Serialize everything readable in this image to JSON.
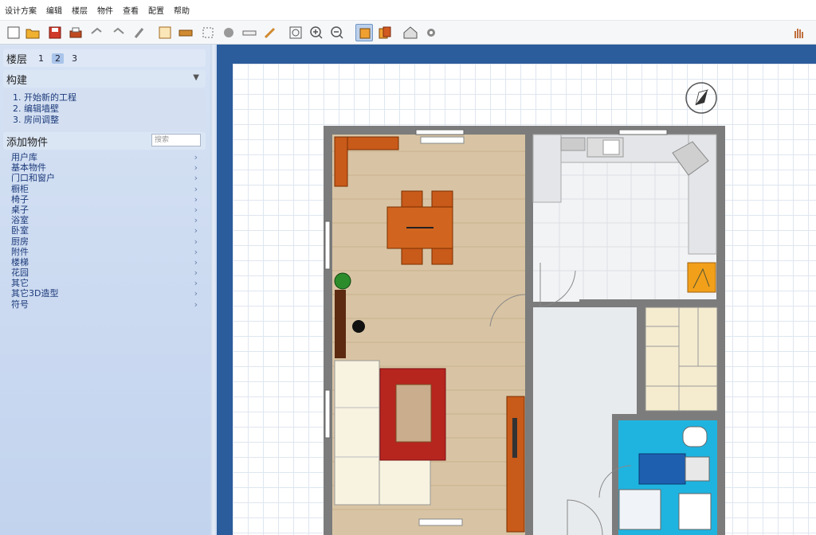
{
  "menu": [
    "设计方案",
    "编辑",
    "楼层",
    "物件",
    "查看",
    "配置",
    "帮助"
  ],
  "toolbar": {
    "buttons": [
      "new-icon",
      "open-folder-icon",
      "save-icon",
      "print-icon",
      "undo-icon",
      "redo-icon",
      "brush-icon",
      "wall-plan-icon",
      "brick-icon",
      "select-icon",
      "rotate-3d-icon",
      "measure-icon",
      "pencil-icon",
      "zoom-fit-icon",
      "zoom-in-icon",
      "zoom-out-icon",
      "plan-2d-icon",
      "plan-3d-icon",
      "house-icon",
      "settings-icon",
      "hand-pan-icon"
    ],
    "active": "plan-2d-icon"
  },
  "left": {
    "floors_label": "楼层",
    "floors": [
      "1",
      "2",
      "3"
    ],
    "active_floor": "2",
    "build_label": "构建",
    "steps": [
      "1.  开始新的工程",
      "2.  编辑墙壁",
      "3.  房间调整"
    ],
    "add_objects_label": "添加物件",
    "search_placeholder": "搜索",
    "categories": [
      "用户库",
      "基本物件",
      "门口和窗户",
      "橱柜",
      "椅子",
      "桌子",
      "浴室",
      "卧室",
      "厨房",
      "附件",
      "楼梯",
      "花园",
      "其它",
      "其它3D造型",
      "符号"
    ]
  },
  "plan": {
    "colors": {
      "wall": "#7c7c7c",
      "wood": "#d8c4a4",
      "furniture": "#c85a1a",
      "rug": "#b7251f",
      "sofa": "#f7f3e0",
      "bath_tile": "#1fb4e0",
      "floor_tile": "#f2f3f5",
      "canvas_bg": "#2b5c9b"
    }
  }
}
